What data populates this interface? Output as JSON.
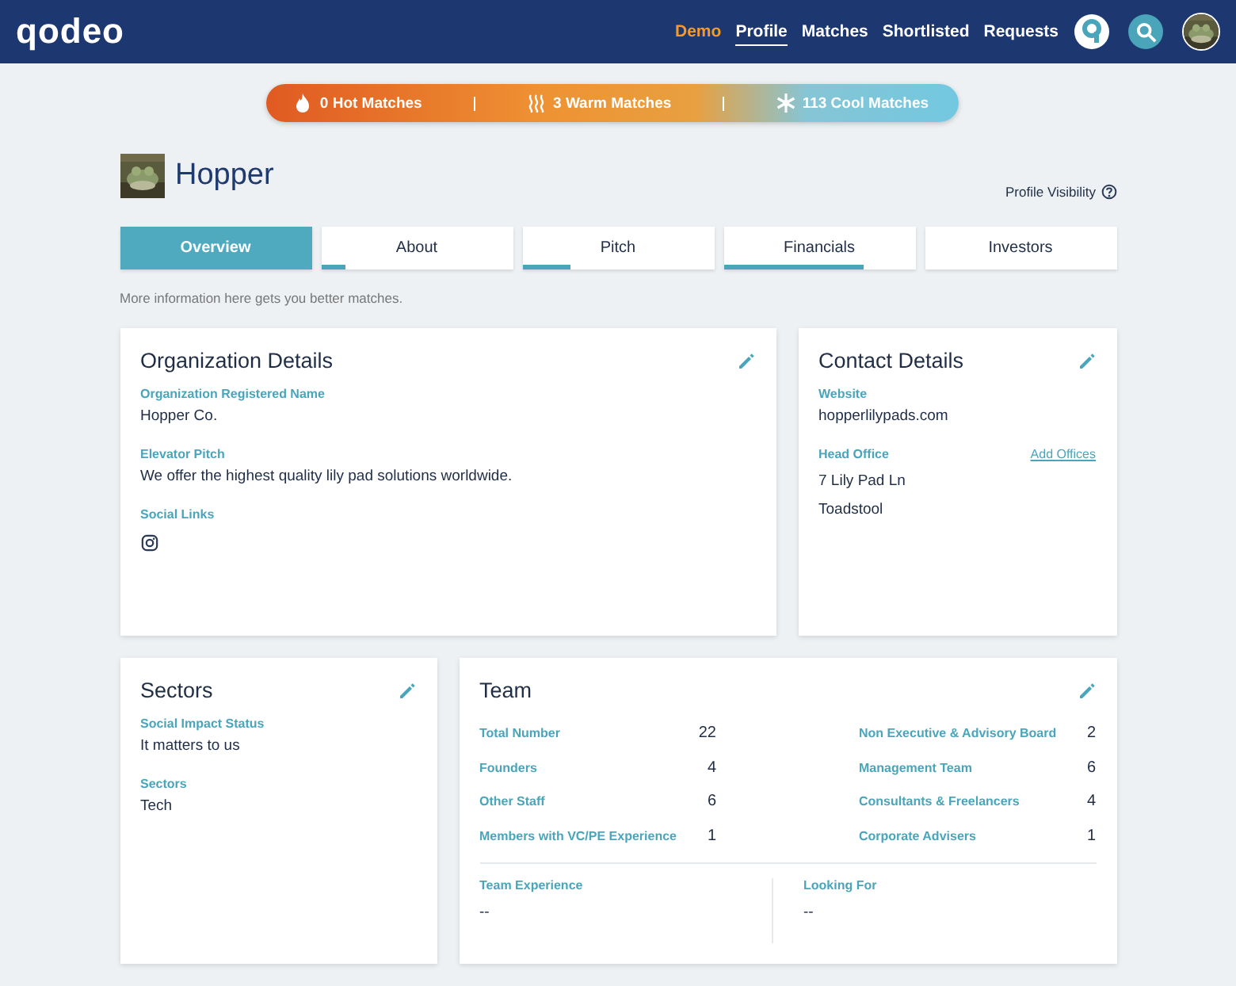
{
  "header": {
    "logo": "qodeo",
    "nav": [
      {
        "label": "Demo",
        "highlighted": true,
        "selected": false
      },
      {
        "label": "Profile",
        "highlighted": false,
        "selected": true
      },
      {
        "label": "Matches",
        "highlighted": false,
        "selected": false
      },
      {
        "label": "Shortlisted",
        "highlighted": false,
        "selected": false
      },
      {
        "label": "Requests",
        "highlighted": false,
        "selected": false
      }
    ]
  },
  "matches": [
    {
      "kind": "hot",
      "label": "0 Hot Matches"
    },
    {
      "kind": "warm",
      "label": "3 Warm Matches"
    },
    {
      "kind": "cool",
      "label": "113 Cool Matches"
    }
  ],
  "profile": {
    "name": "Hopper",
    "visibility": "Profile Visibility"
  },
  "tabs": [
    {
      "label": "Overview",
      "selected": true
    },
    {
      "label": "About",
      "selected": false,
      "level": 0.13
    },
    {
      "label": "Pitch",
      "selected": false,
      "level": 0.25
    },
    {
      "label": "Financials",
      "selected": false,
      "level": 0.73
    },
    {
      "label": "Investors",
      "selected": false
    }
  ],
  "hint": "More information here gets you better matches.",
  "organization": {
    "title": "Organization Details",
    "fields": [
      {
        "label": "Organization Registered Name",
        "value": "Hopper Co."
      },
      {
        "label": "Elevator Pitch",
        "value": "We offer the highest quality lily pad solutions worldwide."
      }
    ],
    "social_label": "Social Links"
  },
  "contact": {
    "title": "Contact Details",
    "website_label": "Website",
    "website": "hopperlilypads.com",
    "office_label": "Head Office",
    "add_link": "Add Offices",
    "address": [
      "7 Lily Pad Ln",
      "Toadstool"
    ]
  },
  "sectors": {
    "title": "Sectors",
    "fields": [
      {
        "label": "Social Impact Status",
        "value": "It matters to us"
      },
      {
        "label": "Sectors",
        "value": "Tech"
      }
    ]
  },
  "team": {
    "title": "Team",
    "left": [
      {
        "label": "Total Number",
        "value": "22"
      },
      {
        "label": "Founders",
        "value": "4"
      },
      {
        "label": "Other Staff",
        "value": "6"
      },
      {
        "label": "Members with VC/PE Experience",
        "value": "1"
      }
    ],
    "right": [
      {
        "label": "Non Executive & Advisory Board",
        "value": "2"
      },
      {
        "label": "Management Team",
        "value": "6"
      },
      {
        "label": "Consultants & Freelancers",
        "value": "4"
      },
      {
        "label": "Corporate Advisers",
        "value": "1"
      }
    ],
    "bottom": [
      {
        "label": "Team Experience",
        "value": "--"
      },
      {
        "label": "Looking For",
        "value": "--"
      }
    ]
  }
}
